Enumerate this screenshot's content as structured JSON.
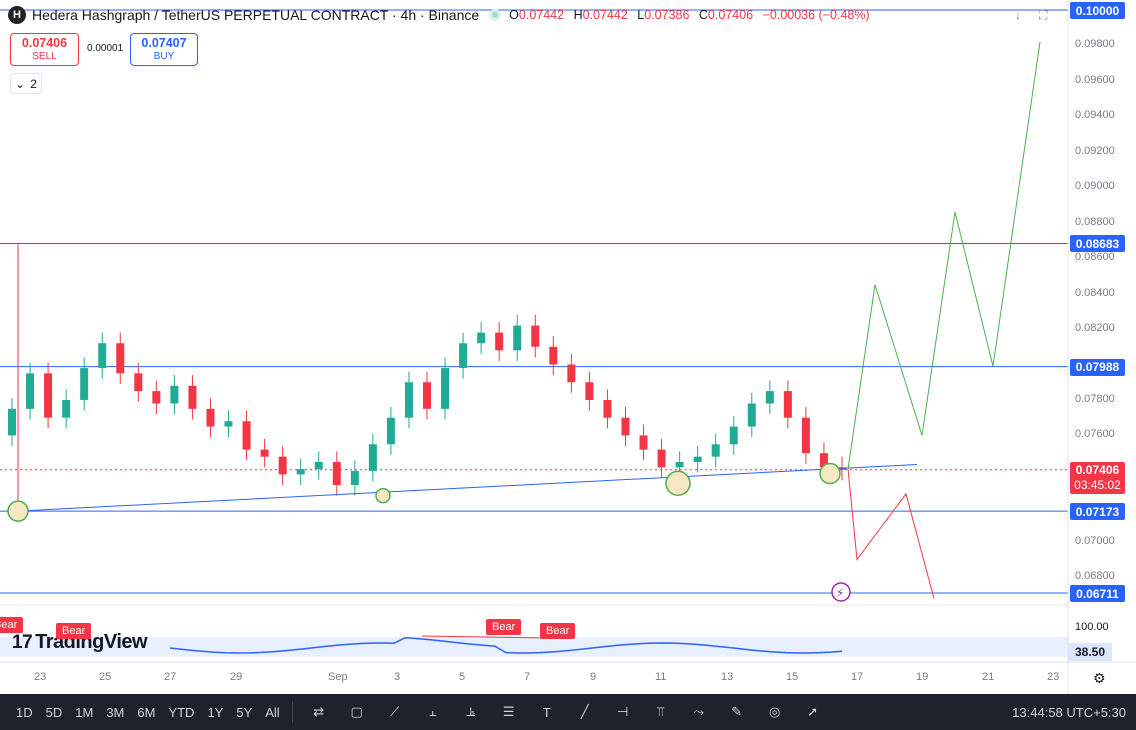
{
  "legend": {
    "logo_letter": "H",
    "title": "Hedera Hashgraph / TetherUS PERPETUAL CONTRACT · 4h · Binance",
    "o_label": "O",
    "o_value": "0.07442",
    "h_label": "H",
    "h_value": "0.07442",
    "l_label": "L",
    "l_value": "0.07386",
    "c_label": "C",
    "c_value": "0.07406",
    "change": "−0.00036 (−0.48%)"
  },
  "trade": {
    "sell_price": "0.07406",
    "sell_label": "SELL",
    "spread": "0.00001",
    "buy_price": "0.07407",
    "buy_label": "BUY"
  },
  "collapse": {
    "count": "2"
  },
  "top_icons": [
    "arrow-down-icon",
    "fullscreen-icon"
  ],
  "price_scale": {
    "ticks": [
      "0.09800",
      "0.09600",
      "0.09400",
      "0.09200",
      "0.09000",
      "0.08800",
      "0.08600",
      "0.08400",
      "0.08200",
      "0.07800",
      "0.07600",
      "0.07000",
      "0.06800"
    ],
    "levels": [
      {
        "value": "0.10000",
        "color": "#2962ff"
      },
      {
        "value": "0.08683",
        "color": "#2962ff"
      },
      {
        "value": "0.07988",
        "color": "#2962ff"
      },
      {
        "value": "0.07173",
        "color": "#2962ff"
      },
      {
        "value": "0.06711",
        "color": "#2962ff"
      }
    ],
    "current_price": "0.07406",
    "countdown": "03:45:02",
    "current_color": "#f23645"
  },
  "oscillator": {
    "scale_top": "100.00",
    "value": "38.50",
    "bear_tags": [
      "Bear",
      "Bear",
      "Bear"
    ]
  },
  "watermark": {
    "text": "TradingView",
    "mark": "17"
  },
  "time_axis": [
    "23",
    "25",
    "27",
    "29",
    "Sep",
    "3",
    "5",
    "7",
    "9",
    "11",
    "13",
    "15",
    "17",
    "19",
    "21",
    "23"
  ],
  "timeframes": [
    "1D",
    "5D",
    "1M",
    "3M",
    "6M",
    "YTD",
    "1Y",
    "5Y",
    "All"
  ],
  "tools": [
    "compare-icon",
    "rectangle-icon",
    "path-icon",
    "long-position-icon",
    "short-position-icon",
    "parallel-lines-icon",
    "text-icon",
    "trendline-icon",
    "fib-icon",
    "pitchfork-icon",
    "brush-icon",
    "pen-icon",
    "measure-icon",
    "arrow-icon"
  ],
  "clock": "13:44:58 UTC+5:30",
  "colors": {
    "up": "#22ab94",
    "down": "#f23645",
    "level_line": "#2962ff",
    "projection_up": "#4caf50",
    "projection_down": "#f23645",
    "osc_line": "#2962ff"
  },
  "chart_data": {
    "type": "candlestick",
    "symbol": "HBARUSDT.P",
    "interval": "4h",
    "x": [
      "23",
      "25",
      "27",
      "29",
      "Sep",
      "3",
      "5",
      "7",
      "9",
      "11",
      "13",
      "15",
      "17",
      "19",
      "21",
      "23"
    ],
    "ylim": [
      0.0665,
      0.1005
    ],
    "horizontal_levels": [
      0.1,
      0.08683,
      0.07988,
      0.07173,
      0.06711
    ],
    "current_price": 0.07406,
    "ohlc_last": {
      "o": 0.07442,
      "h": 0.07442,
      "l": 0.07386,
      "c": 0.07406
    },
    "closes_approx": [
      0.0775,
      0.0795,
      0.077,
      0.078,
      0.0798,
      0.0812,
      0.0795,
      0.0785,
      0.0778,
      0.0788,
      0.0775,
      0.0765,
      0.0768,
      0.0752,
      0.0748,
      0.0738,
      0.0741,
      0.0745,
      0.0732,
      0.074,
      0.0755,
      0.077,
      0.079,
      0.0775,
      0.0798,
      0.0812,
      0.0818,
      0.0808,
      0.0822,
      0.081,
      0.08,
      0.079,
      0.078,
      0.077,
      0.076,
      0.0752,
      0.0742,
      0.0745,
      0.0748,
      0.0755,
      0.0765,
      0.0778,
      0.0785,
      0.077,
      0.075,
      0.0742,
      0.07406
    ],
    "trendline": {
      "from": 0.07173,
      "to": 0.07436
    },
    "projection_up": [
      0.0741,
      0.0845,
      0.076,
      0.0886,
      0.0799,
      0.0982
    ],
    "projection_down": [
      0.0741,
      0.069,
      0.0727,
      0.0668
    ],
    "oscillator_value": 38.5
  }
}
